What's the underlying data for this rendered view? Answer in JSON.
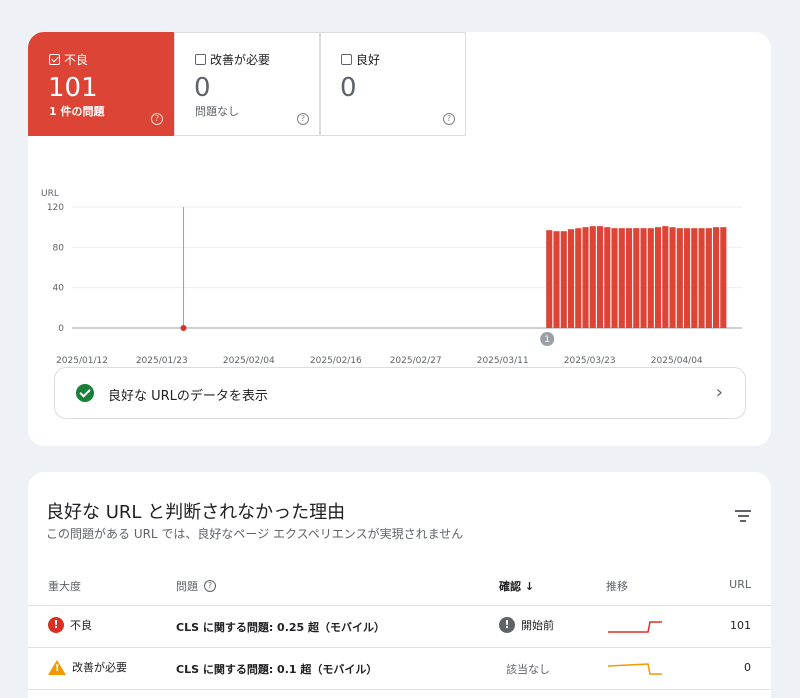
{
  "tiles": [
    {
      "label": "不良",
      "value": "101",
      "sub": "1 件の問題",
      "active": true
    },
    {
      "label": "改善が必要",
      "value": "0",
      "sub": "問題なし",
      "active": false
    },
    {
      "label": "良好",
      "value": "0",
      "sub": "",
      "active": false
    }
  ],
  "chart_data": {
    "type": "bar",
    "ylabel": "URL",
    "ylim": [
      0,
      120
    ],
    "yticks": [
      0,
      40,
      80,
      120
    ],
    "xticks": [
      "2025/01/12",
      "2025/01/23",
      "2025/02/04",
      "2025/02/16",
      "2025/02/27",
      "2025/03/11",
      "2025/03/23",
      "2025/04/04"
    ],
    "x_start": "2025/01/12",
    "x_end": "2025/04/13",
    "bar_start": "2025/03/17",
    "values": [
      97,
      96,
      96,
      98,
      99,
      100,
      101,
      101,
      100,
      99,
      99,
      99,
      99,
      99,
      99,
      100,
      101,
      100,
      99,
      99,
      99,
      99,
      99,
      100,
      100
    ],
    "annotation_date": "2025/01/26",
    "annotation_value": 0,
    "marker_date": "2025/03/17",
    "marker_label": "1",
    "bar_color": "#dc4535"
  },
  "good_link": {
    "text": "良好な URLのデータを表示",
    "chevron": "›"
  },
  "issues": {
    "title": "良好な URL と判断されなかった理由",
    "subtitle": "この問題がある URL では、良好なページ エクスペリエンスが実現されません",
    "headers": {
      "severity": "重大度",
      "issue": "問題",
      "validation": "確認 ↓",
      "trend": "推移",
      "urls": "URL"
    },
    "rows": [
      {
        "severity": "不良",
        "issue": "CLS に関する問題: 0.25 超（モバイル）",
        "validation": "開始前",
        "urls": "101",
        "trend_color": "#d93025"
      },
      {
        "severity": "改善が必要",
        "issue": "CLS に関する問題: 0.1 超（モバイル）",
        "validation": "該当なし",
        "urls": "0",
        "trend_color": "#f29900"
      }
    ]
  }
}
